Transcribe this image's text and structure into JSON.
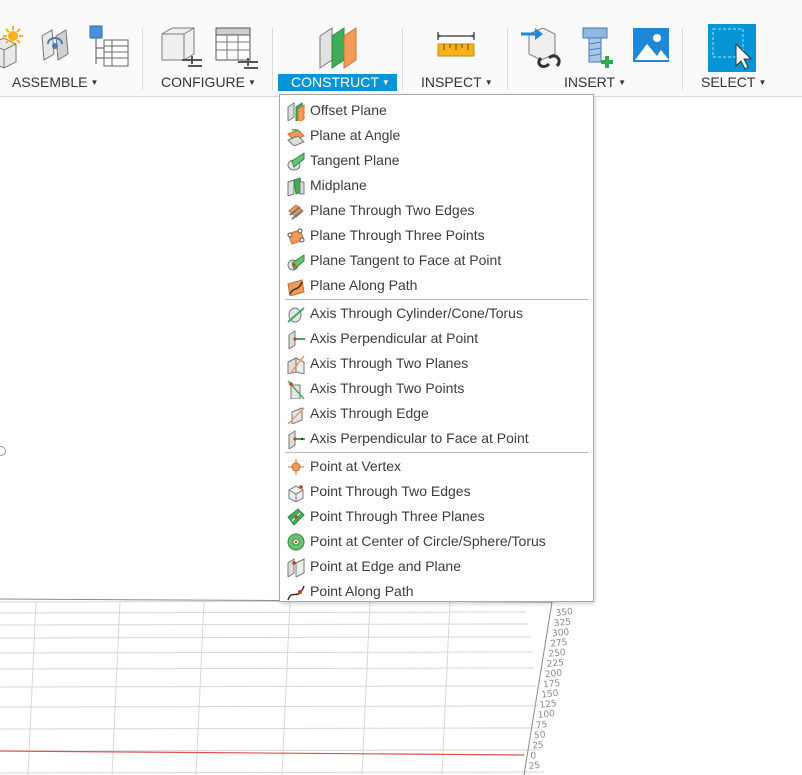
{
  "toolbar": {
    "groups": [
      {
        "id": "assemble",
        "label": "ASSEMBLE"
      },
      {
        "id": "configure",
        "label": "CONFIGURE"
      },
      {
        "id": "construct",
        "label": "CONSTRUCT"
      },
      {
        "id": "inspect",
        "label": "INSPECT"
      },
      {
        "id": "insert",
        "label": "INSERT"
      },
      {
        "id": "select",
        "label": "SELECT"
      }
    ],
    "active_group": "construct",
    "caret": "▼",
    "accent_color": "#0696d7"
  },
  "construct_menu": {
    "planes": [
      {
        "label": "Offset Plane",
        "icon": "offset-plane-icon"
      },
      {
        "label": "Plane at Angle",
        "icon": "plane-at-angle-icon"
      },
      {
        "label": "Tangent Plane",
        "icon": "tangent-plane-icon"
      },
      {
        "label": "Midplane",
        "icon": "midplane-icon"
      },
      {
        "label": "Plane Through Two Edges",
        "icon": "plane-two-edges-icon"
      },
      {
        "label": "Plane Through Three Points",
        "icon": "plane-three-points-icon"
      },
      {
        "label": "Plane Tangent to Face at Point",
        "icon": "plane-tangent-face-icon"
      },
      {
        "label": "Plane Along Path",
        "icon": "plane-along-path-icon"
      }
    ],
    "axes": [
      {
        "label": "Axis Through Cylinder/Cone/Torus",
        "icon": "axis-cylinder-icon"
      },
      {
        "label": "Axis Perpendicular at Point",
        "icon": "axis-perpendicular-point-icon"
      },
      {
        "label": "Axis Through Two Planes",
        "icon": "axis-two-planes-icon"
      },
      {
        "label": "Axis Through Two Points",
        "icon": "axis-two-points-icon"
      },
      {
        "label": "Axis Through Edge",
        "icon": "axis-edge-icon"
      },
      {
        "label": "Axis Perpendicular to Face at Point",
        "icon": "axis-perpendicular-face-icon"
      }
    ],
    "points": [
      {
        "label": "Point at Vertex",
        "icon": "point-vertex-icon"
      },
      {
        "label": "Point Through Two Edges",
        "icon": "point-two-edges-icon"
      },
      {
        "label": "Point Through Three Planes",
        "icon": "point-three-planes-icon"
      },
      {
        "label": "Point at Center of Circle/Sphere/Torus",
        "icon": "point-center-icon"
      },
      {
        "label": "Point at Edge and Plane",
        "icon": "point-edge-plane-icon"
      },
      {
        "label": "Point Along Path",
        "icon": "point-along-path-icon"
      }
    ]
  },
  "viewport": {
    "ruler_labels": [
      "350",
      "325",
      "300",
      "275",
      "250",
      "225",
      "200",
      "175",
      "150",
      "125",
      "100",
      "75",
      "50",
      "25",
      "0",
      "25"
    ],
    "axis_color": "#e05050"
  }
}
